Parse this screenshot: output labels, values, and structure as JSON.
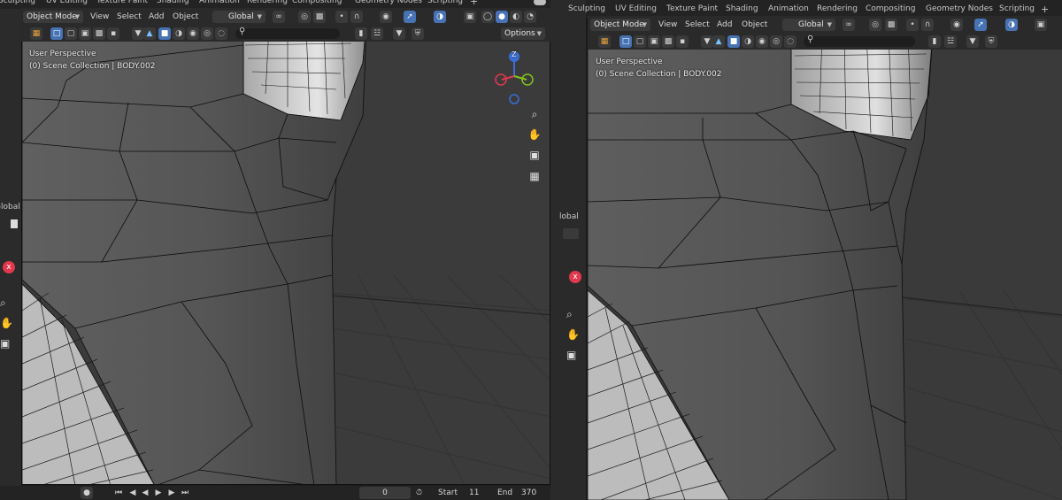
{
  "workspace_tabs": [
    "Sculpting",
    "UV Editing",
    "Texture Paint",
    "Shading",
    "Animation",
    "Rendering",
    "Compositing",
    "Geometry Nodes",
    "Scripting"
  ],
  "workspace_add": "+",
  "left_viewport": {
    "mode": "Object Mode",
    "menus": [
      "View",
      "Select",
      "Add",
      "Object"
    ],
    "transform_orientation": "Global",
    "options_label": "Options",
    "overlay_title": "User Perspective",
    "overlay_collection": "(0) Scene Collection | BODY.002",
    "gizmo_axis": "Z"
  },
  "right_viewport": {
    "mode": "Object Mode",
    "menus": [
      "View",
      "Select",
      "Add",
      "Object"
    ],
    "transform_orientation": "Global",
    "overlay_title": "User Perspective",
    "overlay_collection": "(0) Scene Collection | BODY.002"
  },
  "side_fragments": {
    "left_global": "lobal",
    "middle_global": "Global"
  },
  "timeline": {
    "current_frame": "0",
    "start_label": "Start",
    "start_value": "11",
    "end_label": "End",
    "end_value": "370"
  },
  "colors": {
    "mesh_light": "#5a5a5a",
    "mesh_dark": "#3e3e3e",
    "wire": "#0c0c0c",
    "floor": "#393939",
    "accent_blue": "#4772b3",
    "axis_red": "#e0394e",
    "axis_green": "#84c21d",
    "axis_blue": "#3a6ed8"
  }
}
